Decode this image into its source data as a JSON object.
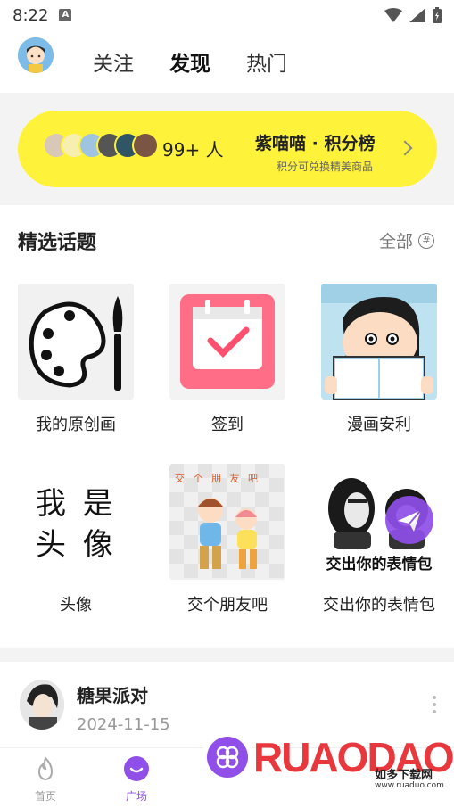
{
  "status_bar": {
    "time": "8:22"
  },
  "top_nav": {
    "tabs": [
      {
        "label": "关注"
      },
      {
        "label": "发现"
      },
      {
        "label": "热门"
      }
    ]
  },
  "banner": {
    "count": "99+ 人",
    "title": "紫喵喵 · 积分榜",
    "subtitle": "积分可兑换精美商品"
  },
  "topics": {
    "title": "精选话题",
    "see_all": "全部",
    "items": [
      {
        "label": "我的原创画"
      },
      {
        "label": "签到"
      },
      {
        "label": "漫画安利"
      },
      {
        "label": "头像",
        "tile_text": "我 是\n头 像"
      },
      {
        "label": "交个朋友吧",
        "tile_text": "交 个 朋 友 吧"
      },
      {
        "label": "交出你的表情包",
        "tile_text": "交出你的表情包"
      }
    ]
  },
  "post": {
    "name": "糖果派对",
    "date": "2024-11-15"
  },
  "bottom_nav": {
    "items": [
      {
        "label": "首页"
      },
      {
        "label": "广场"
      }
    ]
  },
  "watermark": {
    "brand": "RUAODAO",
    "cn": "如多下载网",
    "url": "www.ruaduo.com"
  },
  "colors": {
    "accent": "#8f4fe8",
    "banner": "#fff23a"
  }
}
